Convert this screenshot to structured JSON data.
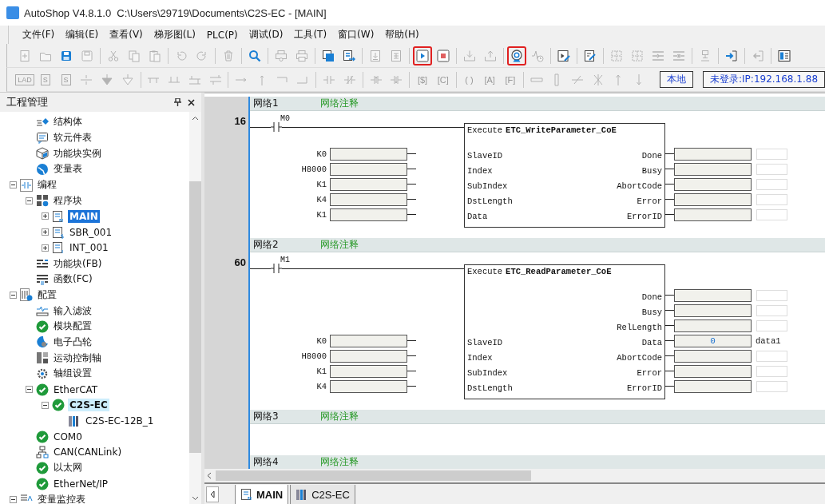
{
  "window": {
    "title": "AutoShop V4.8.1.0  C:\\Users\\29719\\Documents\\C2S-EC - [MAIN]"
  },
  "menu": [
    "文件(F)",
    "编辑(E)",
    "查看(V)",
    "梯形图(L)",
    "PLC(P)",
    "调试(D)",
    "工具(T)",
    "窗口(W)",
    "帮助(H)"
  ],
  "toolbar1": [
    {
      "kind": "new",
      "disabled": true,
      "highlighted": false
    },
    {
      "kind": "open",
      "disabled": true,
      "highlighted": false
    },
    {
      "kind": "save",
      "disabled": false,
      "highlighted": false
    },
    {
      "kind": "saveall",
      "disabled": true,
      "highlighted": false
    },
    {
      "kind": "sep"
    },
    {
      "kind": "cut",
      "disabled": true,
      "highlighted": false
    },
    {
      "kind": "copy",
      "disabled": true,
      "highlighted": false
    },
    {
      "kind": "paste",
      "disabled": true,
      "highlighted": false
    },
    {
      "kind": "sep"
    },
    {
      "kind": "undo",
      "disabled": true,
      "highlighted": false
    },
    {
      "kind": "redo",
      "disabled": true,
      "highlighted": false
    },
    {
      "kind": "sep"
    },
    {
      "kind": "trash",
      "disabled": true,
      "highlighted": false
    },
    {
      "kind": "sep"
    },
    {
      "kind": "search",
      "disabled": false,
      "highlighted": false
    },
    {
      "kind": "sep"
    },
    {
      "kind": "preview",
      "disabled": true,
      "highlighted": false
    },
    {
      "kind": "print",
      "disabled": true,
      "highlighted": false
    },
    {
      "kind": "sep"
    },
    {
      "kind": "windows",
      "disabled": false,
      "highlighted": false
    },
    {
      "kind": "winexport",
      "disabled": false,
      "highlighted": false
    },
    {
      "kind": "sep"
    },
    {
      "kind": "docdown",
      "disabled": true,
      "highlighted": false
    },
    {
      "kind": "docgrid",
      "disabled": true,
      "highlighted": false
    },
    {
      "kind": "sep"
    },
    {
      "kind": "run",
      "disabled": false,
      "highlighted": true
    },
    {
      "kind": "stop",
      "disabled": false,
      "highlighted": false
    },
    {
      "kind": "sep"
    },
    {
      "kind": "download",
      "disabled": true,
      "highlighted": false
    },
    {
      "kind": "upload",
      "disabled": true,
      "highlighted": false
    },
    {
      "kind": "sep"
    },
    {
      "kind": "monitor",
      "disabled": false,
      "highlighted": true
    },
    {
      "kind": "trend",
      "disabled": true,
      "highlighted": false
    },
    {
      "kind": "sep"
    },
    {
      "kind": "runedit",
      "disabled": false,
      "highlighted": false
    },
    {
      "kind": "sep"
    },
    {
      "kind": "edit",
      "disabled": false,
      "highlighted": false
    },
    {
      "kind": "sep"
    },
    {
      "kind": "gridarrow",
      "disabled": true,
      "highlighted": false
    },
    {
      "kind": "gridx",
      "disabled": true,
      "highlighted": false
    },
    {
      "kind": "rowsin",
      "disabled": true,
      "highlighted": false
    },
    {
      "kind": "rowsx",
      "disabled": true,
      "highlighted": false
    },
    {
      "kind": "sep"
    },
    {
      "kind": "plug",
      "disabled": true,
      "highlighted": false
    },
    {
      "kind": "sep"
    },
    {
      "kind": "login",
      "disabled": false,
      "highlighted": false
    },
    {
      "kind": "sep"
    },
    {
      "kind": "logout",
      "disabled": true,
      "highlighted": false
    },
    {
      "kind": "sep"
    },
    {
      "kind": "panel",
      "disabled": false,
      "highlighted": false
    }
  ],
  "toolbar2": [
    {
      "kind": "boxtext",
      "label": "LAD",
      "disabled": true
    },
    {
      "kind": "boxtext",
      "label": "S",
      "disabled": true
    },
    {
      "kind": "boxtext",
      "label": "S",
      "disabled": true
    },
    {
      "kind": "divide",
      "disabled": true
    },
    {
      "kind": "arrowfill",
      "disabled": true
    },
    {
      "kind": "arrowopen",
      "disabled": true
    },
    {
      "kind": "sep"
    },
    {
      "kind": "branch1",
      "disabled": true
    },
    {
      "kind": "branch2",
      "disabled": true
    },
    {
      "kind": "branch3",
      "disabled": true
    },
    {
      "kind": "branch4",
      "disabled": true
    },
    {
      "kind": "sep"
    },
    {
      "kind": "lineright",
      "disabled": true
    },
    {
      "kind": "lineup",
      "disabled": true
    },
    {
      "kind": "corner1",
      "disabled": true
    },
    {
      "kind": "corner2",
      "disabled": true
    },
    {
      "kind": "sep"
    },
    {
      "kind": "contactno",
      "disabled": true
    },
    {
      "kind": "contactnc",
      "disabled": true
    },
    {
      "kind": "sep"
    },
    {
      "kind": "contactp",
      "disabled": true
    },
    {
      "kind": "contactn",
      "disabled": true
    },
    {
      "kind": "sep"
    },
    {
      "kind": "plain",
      "label": "[$]",
      "disabled": true
    },
    {
      "kind": "plain",
      "label": "[C]",
      "disabled": true
    },
    {
      "kind": "sep"
    },
    {
      "kind": "plain",
      "label": "( )",
      "disabled": true
    },
    {
      "kind": "plain",
      "label": "[A]",
      "disabled": true
    },
    {
      "kind": "plain",
      "label": "[F]",
      "disabled": true
    },
    {
      "kind": "sep"
    },
    {
      "kind": "hline",
      "disabled": true
    },
    {
      "kind": "vline",
      "disabled": true
    },
    {
      "kind": "diag",
      "disabled": true
    },
    {
      "kind": "cross",
      "disabled": true
    },
    {
      "kind": "arrowup",
      "disabled": true
    },
    {
      "kind": "arrowdown",
      "disabled": true
    }
  ],
  "status": [
    "本地",
    "未登录:IP:192.168.1.88"
  ],
  "project_panel": {
    "title": "工程管理"
  },
  "tree": {
    "items_below_hidden_parent": [
      {
        "label": "结构体",
        "kind": "struct",
        "selected": false
      },
      {
        "label": "软元件表",
        "kind": "comment",
        "selected": false
      },
      {
        "label": "功能块实例",
        "kind": "cube",
        "selected": false
      },
      {
        "label": "变量表",
        "kind": "globe",
        "selected": false
      }
    ],
    "nodes": [
      {
        "label": "编程",
        "kind": "ladder",
        "selected": false,
        "expanded": true,
        "children": [
          {
            "label": "程序块",
            "kind": "blocks",
            "selected": false,
            "expanded": true,
            "children": [
              {
                "label": "MAIN",
                "kind": "docm",
                "selected": true,
                "expanded": false
              },
              {
                "label": "SBR_001",
                "kind": "docs",
                "selected": false,
                "expanded": false
              },
              {
                "label": "INT_001",
                "kind": "doci",
                "selected": false,
                "expanded": false
              }
            ]
          },
          {
            "label": "功能块(FB)",
            "kind": "fb",
            "selected": false
          },
          {
            "label": "函数(FC)",
            "kind": "fc",
            "selected": false
          }
        ]
      },
      {
        "label": "配置",
        "kind": "config",
        "selected": false,
        "expanded": true,
        "children": [
          {
            "label": "输入滤波",
            "kind": "wave",
            "selected": false
          },
          {
            "label": "模块配置",
            "kind": "check",
            "selected": false
          },
          {
            "label": "电子凸轮",
            "kind": "cam",
            "selected": false
          },
          {
            "label": "运动控制轴",
            "kind": "axis",
            "selected": false
          },
          {
            "label": "轴组设置",
            "kind": "gear",
            "selected": false
          },
          {
            "label": "EtherCAT",
            "kind": "check",
            "selected": false,
            "expanded": true,
            "children": [
              {
                "label": "C2S-EC",
                "kind": "check",
                "selected": false,
                "highlighted": true,
                "expanded": true,
                "children": [
                  {
                    "label": "C2S-EC-12B_1",
                    "kind": "device",
                    "selected": false
                  }
                ]
              }
            ]
          },
          {
            "label": "COM0",
            "kind": "check",
            "selected": false
          },
          {
            "label": "CAN(CANLink)",
            "kind": "network",
            "selected": false
          },
          {
            "label": "以太网",
            "kind": "check",
            "selected": false
          },
          {
            "label": "EtherNet/IP",
            "kind": "check",
            "selected": false
          }
        ]
      },
      {
        "label": "变量监控表",
        "kind": "monitor",
        "selected": false,
        "expanded": true
      }
    ]
  },
  "networks": [
    {
      "label": "网络1",
      "comment": "网络注释",
      "step": "16",
      "rung": {
        "contact": "M0",
        "input": "Execute",
        "block": "ETC_WriteParameter_CoE",
        "rows": [
          {
            "in_value": "K0",
            "in_param": "SlaveID",
            "out_param": "Done"
          },
          {
            "in_value": "H8000",
            "in_param": "Index",
            "out_param": "Busy"
          },
          {
            "in_value": "K1",
            "in_param": "SubIndex",
            "out_param": "AbortCode"
          },
          {
            "in_value": "K4",
            "in_param": "DstLength",
            "out_param": "Error"
          },
          {
            "in_value": "K1",
            "in_param": "Data",
            "out_param": "ErrorID"
          }
        ]
      }
    },
    {
      "label": "网络2",
      "comment": "网络注释",
      "step": "60",
      "rung": {
        "contact": "M1",
        "input": "Execute",
        "block": "ETC_ReadParameter_CoE",
        "rows": [
          {
            "out_param": "Done"
          },
          {
            "out_param": "Busy"
          },
          {
            "out_param": "RelLength"
          },
          {
            "in_value": "K0",
            "in_param": "SlaveID",
            "out_param": "Data",
            "out_value": "0",
            "out_comment": "data1"
          },
          {
            "in_value": "H8000",
            "in_param": "Index",
            "out_param": "AbortCode"
          },
          {
            "in_value": "K1",
            "in_param": "SubIndex",
            "out_param": "Error"
          },
          {
            "in_value": "K4",
            "in_param": "DstLength",
            "out_param": "ErrorID"
          }
        ]
      }
    },
    {
      "label": "网络3",
      "comment": "网络注释"
    },
    {
      "label": "网络4",
      "comment": "网络注释"
    }
  ],
  "tabs": [
    {
      "label": "MAIN",
      "kind": "docm",
      "selected": true
    },
    {
      "label": "C2S-EC",
      "kind": "device",
      "selected": false
    }
  ]
}
